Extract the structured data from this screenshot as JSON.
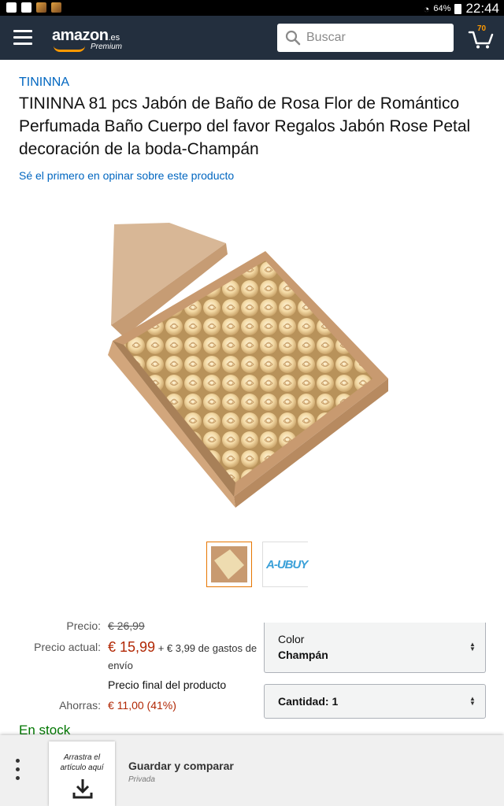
{
  "status_bar": {
    "battery": "64%",
    "time": "22:44"
  },
  "header": {
    "logo_word": "amazon",
    "logo_tld": ".es",
    "logo_sub": "Premium",
    "search_placeholder": "Buscar",
    "cart_count": "70"
  },
  "product": {
    "brand": "TININNA",
    "title": "TININNA 81 pcs Jabón de Baño de Rosa Flor de Romántico Perfumada Baño Cuerpo del favor Regalos Jabón Rose Petal decoración de la boda-Champán",
    "review_link": "Sé el primero en opinar sobre este producto",
    "thumb_2_text": "A-UBUY"
  },
  "price": {
    "precio_label": "Precio:",
    "precio_old": "€ 26,99",
    "actual_label": "Precio actual:",
    "actual_value": "€ 15,99",
    "shipping": "+ € 3,99 de gastos de envío",
    "final_note": "Precio final del producto",
    "ahorras_label": "Ahorras:",
    "ahorras_value": "€ 11,00 (41%)"
  },
  "options": {
    "color_label": "Color",
    "color_value": "Champán",
    "qty_label": "Cantidad:",
    "qty_value": "1"
  },
  "stock": "En stock",
  "bottom_bar": {
    "drop_text": "Arrastra el artículo aquí",
    "save_title": "Guardar y comparar",
    "save_sub": "Privada"
  },
  "colors": {
    "header_bg": "#232f3e",
    "link": "#0066c0",
    "price": "#b12704",
    "stock": "#007600",
    "accent": "#ff9900"
  }
}
